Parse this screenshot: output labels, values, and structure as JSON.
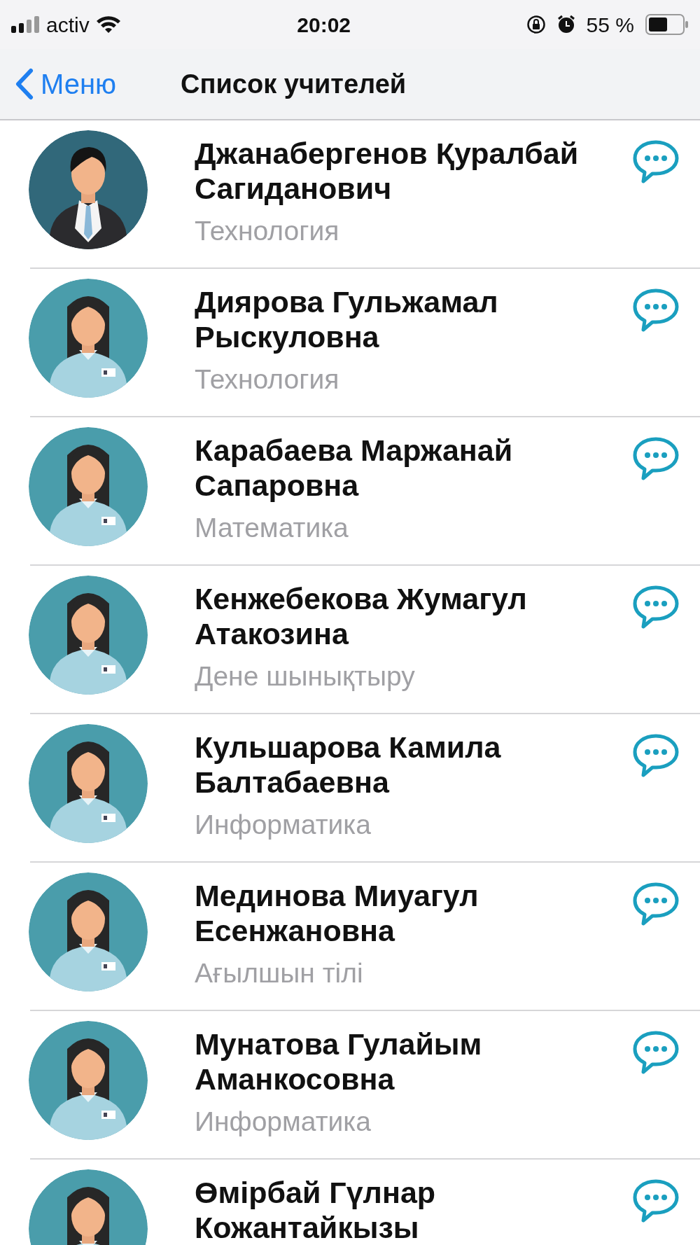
{
  "status_bar": {
    "carrier": "activ",
    "time": "20:02",
    "battery": "55 %"
  },
  "nav_bar": {
    "back": "Меню",
    "title": "Список учителей"
  },
  "teachers": [
    {
      "name": "Джанабергенов Қуралбай Сагиданович",
      "subject": "Технология",
      "kind": "male"
    },
    {
      "name": "Диярова Гульжамал Рыскуловна",
      "subject": "Технология",
      "kind": "female"
    },
    {
      "name": "Карабаева Маржанай Сапаровна",
      "subject": "Математика",
      "kind": "female"
    },
    {
      "name": "Кенжебекова Жумагул Атакозина",
      "subject": "Дене шынықтыру",
      "kind": "female"
    },
    {
      "name": "Кульшарова Камила Балтабаевна",
      "subject": "Информатика",
      "kind": "female"
    },
    {
      "name": "Мединова Миуагул Есенжановна",
      "subject": "Ағылшын тілі",
      "kind": "female"
    },
    {
      "name": "Мунатова Гулайым Аманкосовна",
      "subject": "Информатика",
      "kind": "female"
    },
    {
      "name": "Өмірбай Гүлнар Кожантайкызы",
      "kind": "female"
    }
  ]
}
